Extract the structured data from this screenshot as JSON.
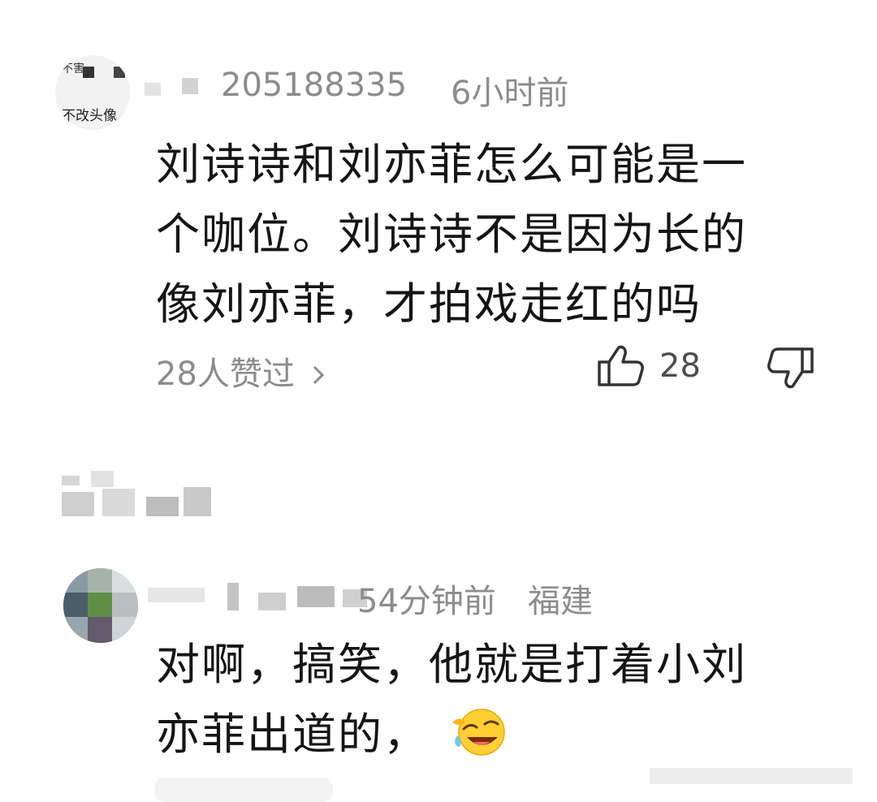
{
  "comments": [
    {
      "avatar_text": {
        "line1": "不害",
        "line2": "不改头像"
      },
      "username_visible": "205188335",
      "time": "6小时前",
      "text_lines": [
        "刘诗诗和刘亦菲怎么可能是一",
        "个咖位。刘诗诗不是因为长的",
        "像刘亦菲，才拍戏走红的吗"
      ],
      "likers_label": "28人赞过",
      "like_count": "28"
    },
    {
      "time": "54分钟前",
      "location": "福建",
      "text_lines": [
        "对啊，搞笑，他就是打着小刘",
        "亦菲出道的，"
      ],
      "emoji": "rolling-on-floor-laughing-emoji"
    }
  ],
  "icons": {
    "like": "thumbs-up-icon",
    "dislike": "thumbs-down-icon",
    "chevron": "chevron-right-icon"
  },
  "colors": {
    "text": "#151515",
    "meta": "#8c8c8c"
  }
}
